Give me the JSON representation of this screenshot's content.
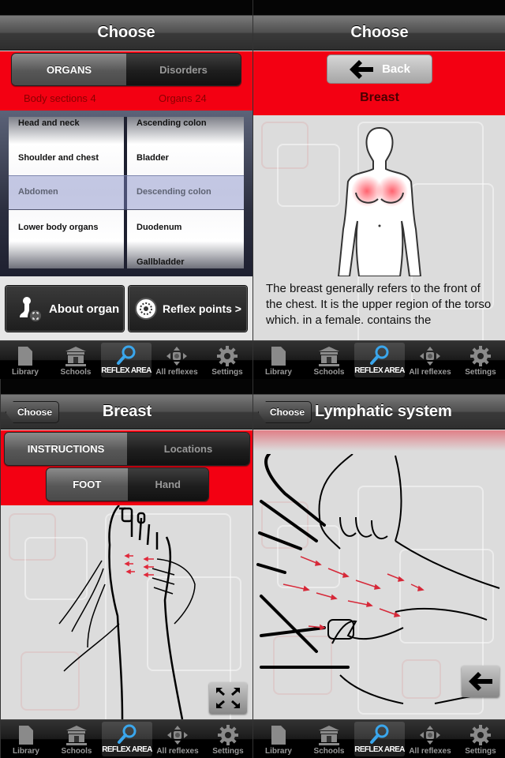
{
  "screens": [
    {
      "nav_title": "Choose",
      "segmented": {
        "active": "ORGANS",
        "inactive": "Disorders"
      },
      "counts": {
        "left": "Body sections 4",
        "right": "Organs 24"
      },
      "picker": {
        "left_column": [
          "Head and neck",
          "Shoulder and chest",
          "Abdomen",
          "Lower body organs"
        ],
        "left_selected": "Abdomen",
        "right_column": [
          "Ascending colon",
          "Bladder",
          "Descending colon",
          "Duodenum",
          "Gallbladder"
        ],
        "right_selected": "Descending colon"
      },
      "buttons": {
        "about": "About organ",
        "reflex": "Reflex points >"
      },
      "about_icon": "person-organ-icon",
      "reflex_icon": "reflex-point-icon"
    },
    {
      "nav_title": "Choose",
      "back_label": "Back",
      "organ_title": "Breast",
      "illustration": "female-torso-breast-highlight",
      "description": "The breast generally refers to the front of the chest. It is the upper region of the torso which. in a female. contains the"
    },
    {
      "nav_title": "Breast",
      "back_label": "Choose",
      "segmented_top": {
        "active": "INSTRUCTIONS",
        "inactive": "Locations"
      },
      "segmented_bottom": {
        "active": "FOOT",
        "inactive": "Hand"
      },
      "illustration": "foot-massage-arrows",
      "fullscreen_icon": "expand-arrows-icon"
    },
    {
      "nav_title": "Lymphatic system",
      "back_label": "Choose",
      "illustration": "hand-massage-arrows",
      "back_arrow_icon": "arrow-left-icon"
    }
  ],
  "tabbar": {
    "items": [
      {
        "label": "Library",
        "icon": "document-icon"
      },
      {
        "label": "Schools",
        "icon": "building-icon"
      },
      {
        "label": "REFLEX AREA",
        "icon": "magnifier-icon",
        "active": true
      },
      {
        "label": "All reflexes",
        "icon": "dpad-icon"
      },
      {
        "label": "Settings",
        "icon": "gear-icon"
      }
    ]
  },
  "colors": {
    "accent_red": "#f30012",
    "tab_active_icon": "#3aa6ec",
    "count_text": "#8a0000"
  }
}
